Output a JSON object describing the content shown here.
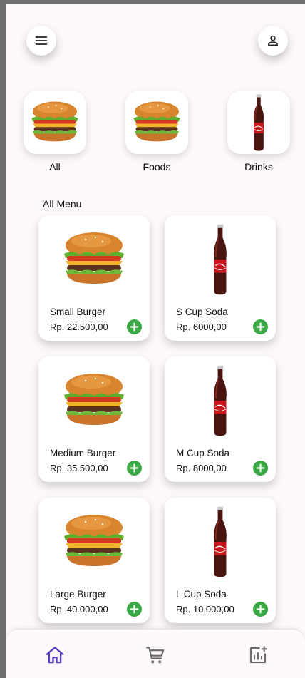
{
  "header": {
    "menu_icon": "menu-icon",
    "profile_icon": "person-icon"
  },
  "categories": [
    {
      "label": "All",
      "icon": "burger-image"
    },
    {
      "label": "Foods",
      "icon": "burger-image"
    },
    {
      "label": "Drinks",
      "icon": "cola-bottle-image"
    }
  ],
  "section_title": "All Menu",
  "menu": [
    {
      "name": "Small Burger",
      "price": "Rp. 22.500,00",
      "image": "burger-image"
    },
    {
      "name": "S Cup Soda",
      "price": "Rp. 6000,00",
      "image": "cola-bottle-image"
    },
    {
      "name": "Medium Burger",
      "price": "Rp. 35.500,00",
      "image": "burger-image"
    },
    {
      "name": "M Cup Soda",
      "price": "Rp. 8000,00",
      "image": "cola-bottle-image"
    },
    {
      "name": "Large Burger",
      "price": "Rp. 40.000,00",
      "image": "burger-image"
    },
    {
      "name": "L Cup Soda",
      "price": "Rp. 10.000,00",
      "image": "cola-bottle-image"
    }
  ],
  "nav": [
    {
      "icon": "home-icon",
      "active": true
    },
    {
      "icon": "cart-icon",
      "active": false
    },
    {
      "icon": "add-chart-icon",
      "active": false
    }
  ],
  "colors": {
    "accent": "#5b3fbf",
    "add_button": "#3aa845",
    "icon": "#6b6b6b",
    "background": "#fdf8fb"
  }
}
